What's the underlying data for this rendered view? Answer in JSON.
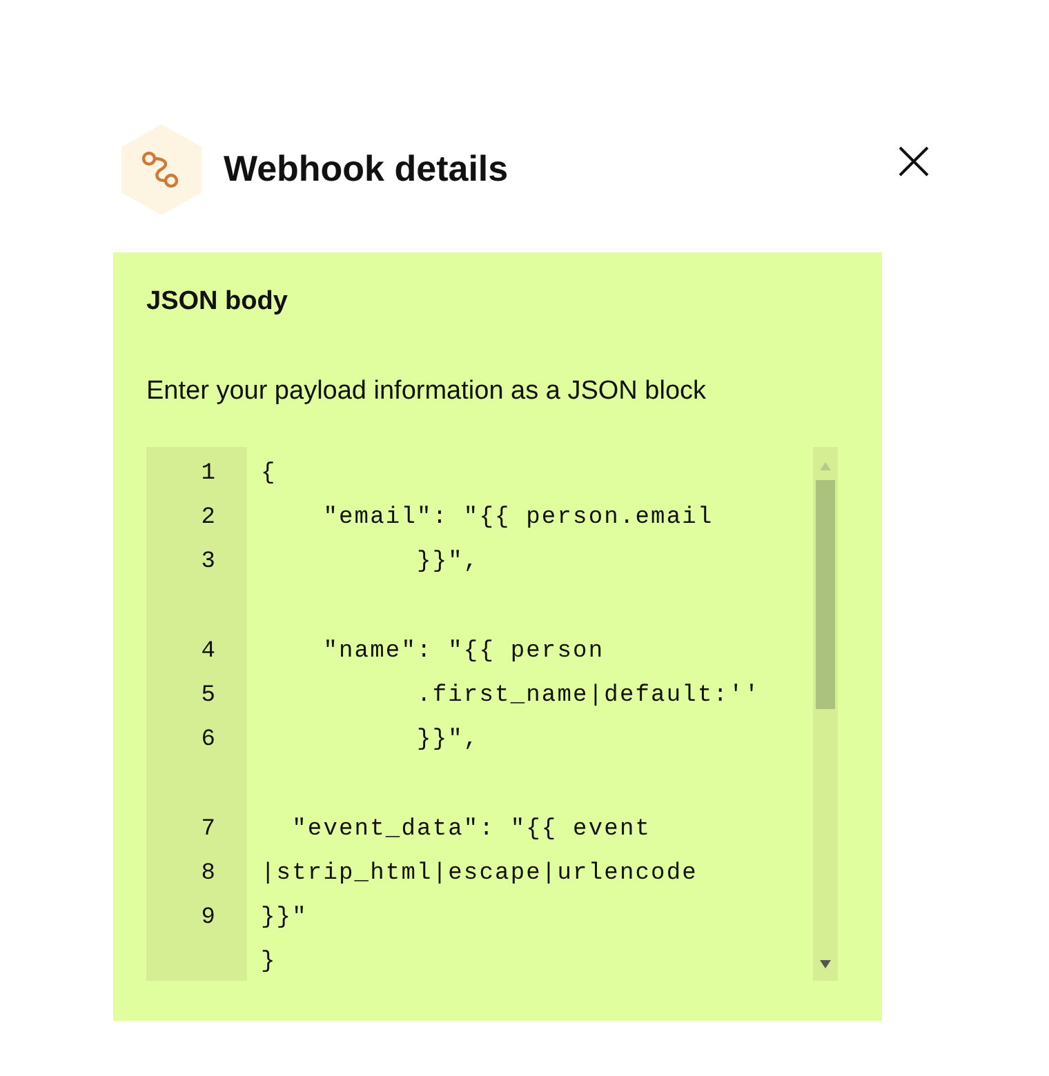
{
  "header": {
    "title": "Webhook details"
  },
  "section": {
    "title": "JSON body",
    "description": "Enter your payload information as a JSON block"
  },
  "editor": {
    "rows": [
      {
        "number": "1",
        "code": "{"
      },
      {
        "number": "2",
        "code": "    \"email\": \"{{ person.email"
      },
      {
        "number": "3",
        "code": "          }}\","
      },
      {
        "code": ""
      },
      {
        "number": "4",
        "code": "    \"name\": \"{{ person"
      },
      {
        "number": "5",
        "code": "          .first_name|default:''"
      },
      {
        "number": "6",
        "code": "          }}\","
      },
      {
        "code": ""
      },
      {
        "number": "7",
        "code": "  \"event_data\": \"{{ event"
      },
      {
        "number": "8",
        "code": "|strip_html|escape|urlencode"
      },
      {
        "number": "9",
        "code": "}}\""
      },
      {
        "code": "}"
      }
    ]
  }
}
